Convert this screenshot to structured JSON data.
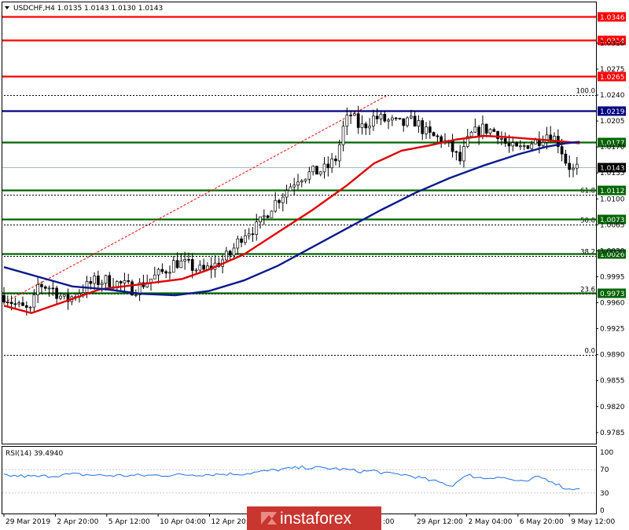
{
  "header": {
    "symbol_text": "USDCHF,H4  1.0135 1.0143 1.0130 1.0143"
  },
  "rsi": {
    "label": "RSI(14) 39.4940",
    "levels": [
      "100",
      "70",
      "30",
      "0"
    ]
  },
  "brand": {
    "name": "instaforex"
  },
  "current_price": "1.0143",
  "colors": {
    "bull_candle": "#ffffff",
    "bear_candle": "#000000",
    "red_line": "#ff0000",
    "blue_line": "#000080",
    "green_line": "#006400",
    "ma_fast": "#e00000",
    "ma_slow": "#0a1a8c",
    "rsi_line": "#1e6fe8",
    "brand_bg": "#c8362f"
  },
  "chart_data": {
    "type": "candlestick",
    "symbol": "USDCHF",
    "timeframe": "H4",
    "ohlc_last": {
      "open": 1.0135,
      "high": 1.0143,
      "low": 1.013,
      "close": 1.0143
    },
    "ylim": [
      0.977,
      1.0365
    ],
    "y_ticks": [
      "1.0310",
      "1.0275",
      "1.0240",
      "1.0205",
      "1.0170",
      "1.0135",
      "1.0100",
      "1.0065",
      "1.0030",
      "0.9995",
      "0.9960",
      "0.9925",
      "0.9890",
      "0.9855",
      "0.9820",
      "0.9785"
    ],
    "x_ticks": [
      "29 Mar 2019",
      "2 Apr 20:00",
      "5 Apr 12:00",
      "10 Apr 04:00",
      "12 Apr 20:00",
      "29 Apr 12:00",
      "2 May 04:00",
      "6 May 20:00",
      "9 May 12:00"
    ],
    "x_tick_values": [
      0,
      15,
      30,
      45,
      60,
      120,
      135,
      150,
      165
    ],
    "hidden_x_tick_fragment": ":00",
    "horizontal_levels": [
      {
        "price": 1.0346,
        "label": "1.0346",
        "color": "red"
      },
      {
        "price": 1.0314,
        "label": "1.0314",
        "color": "red"
      },
      {
        "price": 1.0265,
        "label": "1.0265",
        "color": "red"
      },
      {
        "price": 1.0219,
        "label": "1.0219",
        "color": "blue"
      },
      {
        "price": 1.0177,
        "label": "1.0177",
        "color": "green"
      },
      {
        "price": 1.0112,
        "label": "1.0112",
        "color": "green"
      },
      {
        "price": 1.0073,
        "label": "1.0073",
        "color": "green"
      },
      {
        "price": 1.0026,
        "label": "1.0026",
        "color": "green"
      },
      {
        "price": 0.9973,
        "label": "0.9973",
        "color": "green"
      }
    ],
    "fibonacci": [
      {
        "label": "100.0",
        "price": 1.024
      },
      {
        "label": "61.8",
        "price": 1.0106
      },
      {
        "label": "50.0",
        "price": 1.0065
      },
      {
        "label": "38.2",
        "price": 1.0023
      },
      {
        "label": "23.6",
        "price": 0.9972
      },
      {
        "label": "0.0",
        "price": 0.989
      }
    ],
    "fib_trendline": {
      "from": [
        0,
        0.996
      ],
      "to": [
        112,
        1.024
      ]
    },
    "ma_fast_points": [
      [
        0,
        0.9956
      ],
      [
        8,
        0.9946
      ],
      [
        18,
        0.9962
      ],
      [
        28,
        0.9978
      ],
      [
        40,
        0.9985
      ],
      [
        52,
        0.9992
      ],
      [
        60,
        1.0005
      ],
      [
        70,
        1.0025
      ],
      [
        80,
        1.0055
      ],
      [
        90,
        1.0085
      ],
      [
        100,
        1.0118
      ],
      [
        108,
        1.0148
      ],
      [
        116,
        1.0165
      ],
      [
        124,
        1.0172
      ],
      [
        132,
        1.018
      ],
      [
        140,
        1.0185
      ],
      [
        148,
        1.0183
      ],
      [
        156,
        1.018
      ],
      [
        164,
        1.0177
      ],
      [
        168,
        1.0175
      ]
    ],
    "ma_slow_points": [
      [
        0,
        1.0008
      ],
      [
        10,
        0.9995
      ],
      [
        20,
        0.9982
      ],
      [
        30,
        0.9978
      ],
      [
        40,
        0.9972
      ],
      [
        50,
        0.997
      ],
      [
        60,
        0.9976
      ],
      [
        70,
        0.999
      ],
      [
        80,
        1.001
      ],
      [
        90,
        1.0035
      ],
      [
        100,
        1.006
      ],
      [
        110,
        1.0085
      ],
      [
        120,
        1.0108
      ],
      [
        130,
        1.0128
      ],
      [
        140,
        1.0145
      ],
      [
        150,
        1.016
      ],
      [
        158,
        1.017
      ],
      [
        164,
        1.0175
      ],
      [
        168,
        1.0177
      ]
    ],
    "candles_close_path": [
      [
        0,
        0.997
      ],
      [
        4,
        0.9955
      ],
      [
        8,
        0.9948
      ],
      [
        10,
        0.9985
      ],
      [
        14,
        0.998
      ],
      [
        18,
        0.9962
      ],
      [
        22,
        0.9975
      ],
      [
        26,
        0.9988
      ],
      [
        30,
        0.999
      ],
      [
        34,
        0.9985
      ],
      [
        38,
        0.9978
      ],
      [
        42,
        0.999
      ],
      [
        46,
        1.0
      ],
      [
        50,
        1.0015
      ],
      [
        54,
        1.001
      ],
      [
        58,
        1.0002
      ],
      [
        62,
        1.0012
      ],
      [
        66,
        1.0025
      ],
      [
        70,
        1.0055
      ],
      [
        74,
        1.0062
      ],
      [
        78,
        1.009
      ],
      [
        82,
        1.011
      ],
      [
        86,
        1.013
      ],
      [
        90,
        1.0135
      ],
      [
        94,
        1.014
      ],
      [
        97,
        1.0155
      ],
      [
        99,
        1.0195
      ],
      [
        101,
        1.0215
      ],
      [
        104,
        1.0195
      ],
      [
        108,
        1.021
      ],
      [
        112,
        1.0205
      ],
      [
        116,
        1.02
      ],
      [
        120,
        1.0205
      ],
      [
        124,
        1.0185
      ],
      [
        128,
        1.018
      ],
      [
        131,
        1.0165
      ],
      [
        133,
        1.015
      ],
      [
        136,
        1.0185
      ],
      [
        140,
        1.0195
      ],
      [
        144,
        1.019
      ],
      [
        147,
        1.017
      ],
      [
        150,
        1.0165
      ],
      [
        153,
        1.0175
      ],
      [
        156,
        1.018
      ],
      [
        159,
        1.019
      ],
      [
        162,
        1.0175
      ],
      [
        164,
        1.015
      ],
      [
        166,
        1.0138
      ],
      [
        168,
        1.0143
      ]
    ],
    "rsi_path": [
      [
        0,
        60
      ],
      [
        10,
        58
      ],
      [
        20,
        62
      ],
      [
        30,
        60
      ],
      [
        40,
        60
      ],
      [
        50,
        61
      ],
      [
        60,
        62
      ],
      [
        70,
        63
      ],
      [
        80,
        70
      ],
      [
        88,
        74
      ],
      [
        96,
        72
      ],
      [
        100,
        70
      ],
      [
        104,
        67
      ],
      [
        108,
        68
      ],
      [
        112,
        63
      ],
      [
        116,
        62
      ],
      [
        120,
        58
      ],
      [
        124,
        52
      ],
      [
        128,
        47
      ],
      [
        131,
        42
      ],
      [
        133,
        55
      ],
      [
        136,
        60
      ],
      [
        140,
        55
      ],
      [
        144,
        58
      ],
      [
        148,
        53
      ],
      [
        152,
        48
      ],
      [
        156,
        58
      ],
      [
        160,
        50
      ],
      [
        163,
        40
      ],
      [
        165,
        36
      ],
      [
        168,
        39.49
      ]
    ]
  }
}
